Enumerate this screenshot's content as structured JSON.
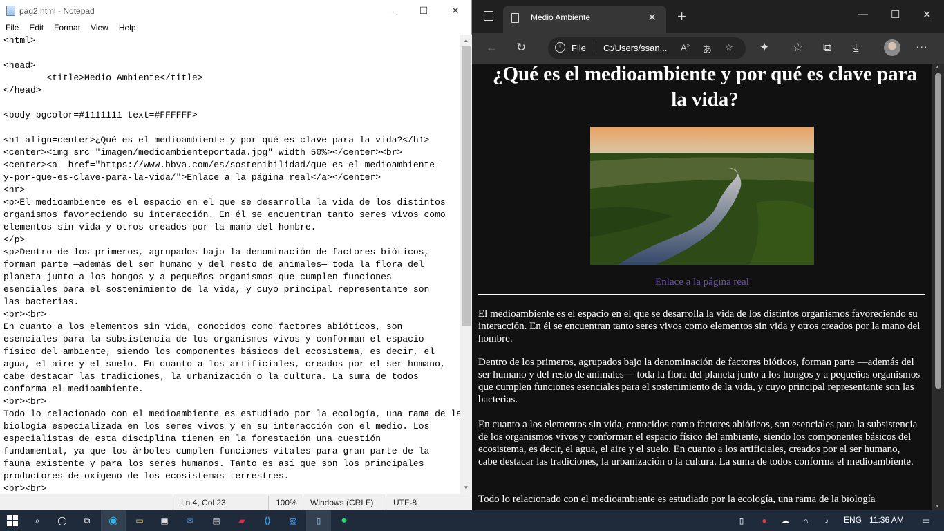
{
  "notepad": {
    "title": "pag2.html - Notepad",
    "menu": [
      "File",
      "Edit",
      "Format",
      "View",
      "Help"
    ],
    "lines": [
      "<html>",
      "",
      "<head>",
      "        <title>Medio Ambiente</title>",
      "</head>",
      "",
      "<body bgcolor=#1111111 text=#FFFFFF>",
      "",
      "<h1 align=center>¿Qué es el medioambiente y por qué es clave para la vida?</h1>",
      "<center><img src=\"imagen/medioambienteportada.jpg\" width=50%></center><br>",
      "<center><a  href=\"https://www.bbva.com/es/sostenibilidad/que-es-el-medioambiente-",
      "y-por-que-es-clave-para-la-vida/\">Enlace a la página real</a></center>",
      "<hr>",
      "<p>El medioambiente es el espacio en el que se desarrolla la vida de los distintos",
      "organismos favoreciendo su interacción. En él se encuentran tanto seres vivos como",
      "elementos sin vida y otros creados por la mano del hombre.",
      "</p>",
      "<p>Dentro de los primeros, agrupados bajo la denominación de factores bióticos,",
      "forman parte —además del ser humano y del resto de animales— toda la flora del",
      "planeta junto a los hongos y a pequeños organismos que cumplen funciones",
      "esenciales para el sostenimiento de la vida, y cuyo principal representante son",
      "las bacterias.",
      "<br><br>",
      "En cuanto a los elementos sin vida, conocidos como factores abióticos, son",
      "esenciales para la subsistencia de los organismos vivos y conforman el espacio",
      "físico del ambiente, siendo los componentes básicos del ecosistema, es decir, el",
      "agua, el aire y el suelo. En cuanto a los artificiales, creados por el ser humano,",
      "cabe destacar las tradiciones, la urbanización o la cultura. La suma de todos",
      "conforma el medioambiente.",
      "<br><br>",
      "Todo lo relacionado con el medioambiente es estudiado por la ecología, una rama de la",
      "biología especializada en los seres vivos y en su interacción con el medio. Los",
      "especialistas de esta disciplina tienen en la forestación una cuestión",
      "fundamental, ya que los árboles cumplen funciones vitales para gran parte de la",
      "fauna existente y para los seres humanos. Tanto es así que son los principales",
      "productores de oxígeno de los ecosistemas terrestres.",
      "<br><br>"
    ],
    "status": {
      "position": "Ln 4, Col 23",
      "zoom": "100%",
      "line_ending": "Windows (CRLF)",
      "encoding": "UTF-8"
    }
  },
  "browser": {
    "tab_title": "Medio Ambiente",
    "address_scheme": "File",
    "address": "C:/Users/ssan...",
    "page": {
      "heading": "¿Qué es el medioambiente y por qué es clave para la vida?",
      "link": "Enlace a la página real",
      "paragraphs": [
        "El medioambiente es el espacio en el que se desarrolla la vida de los distintos organismos favoreciendo su interacción. En él se encuentran tanto seres vivos como elementos sin vida y otros creados por la mano del hombre.",
        "Dentro de los primeros, agrupados bajo la denominación de factores bióticos, forman parte —además del ser humano y del resto de animales— toda la flora del planeta junto a los hongos y a pequeños organismos que cumplen funciones esenciales para el sostenimiento de la vida, y cuyo principal representante son las bacterias.",
        "En cuanto a los elementos sin vida, conocidos como factores abióticos, son esenciales para la subsistencia de los organismos vivos y conforman el espacio físico del ambiente, siendo los componentes básicos del ecosistema, es decir, el agua, el aire y el suelo. En cuanto a los artificiales, creados por el ser humano, cabe destacar las tradiciones, la urbanización o la cultura. La suma de todos conforma el medioambiente.",
        "Todo lo relacionado con el medioambiente es estudiado por la ecología, una rama de la biología"
      ]
    }
  },
  "taskbar": {
    "language": "ENG",
    "time": "11:36 AM"
  },
  "colors": {
    "page_bg": "#111111",
    "taskbar_bg": "#1f2a3a",
    "link": "#6a4fb0"
  }
}
